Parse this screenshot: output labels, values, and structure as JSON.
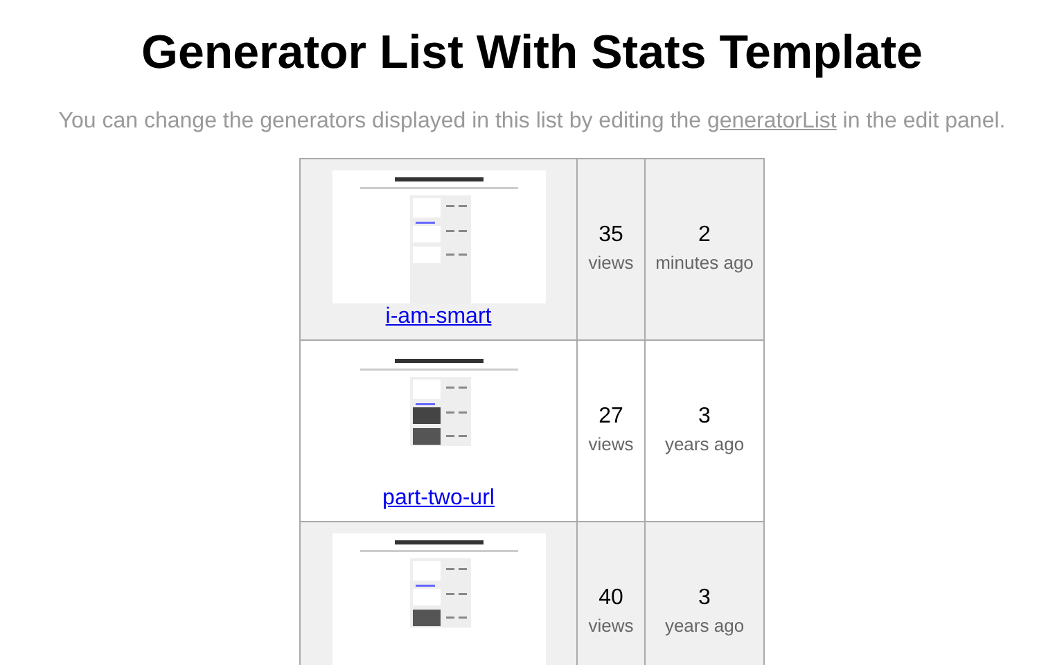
{
  "title": "Generator List With Stats Template",
  "intro": {
    "before": "You can change the generators displayed in this list by editing the",
    "link": "generatorList",
    "after": "in the edit panel."
  },
  "generators": [
    {
      "name": "i-am-smart",
      "views": "35",
      "views_label": "views",
      "age": "2",
      "age_label": "minutes ago"
    },
    {
      "name": "part-two-url",
      "views": "27",
      "views_label": "views",
      "age": "3",
      "age_label": "years ago"
    },
    {
      "views": "40",
      "views_label": "views",
      "age": "3",
      "age_label": "years ago"
    }
  ]
}
